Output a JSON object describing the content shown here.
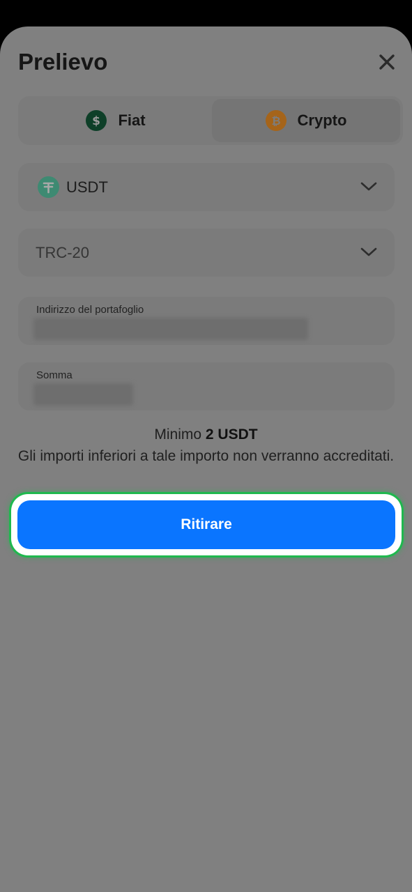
{
  "header": {
    "title": "Prelievo",
    "close_icon": "close-icon"
  },
  "tabs": [
    {
      "label": "Fiat",
      "icon": "dollar-coin-icon",
      "icon_glyph": "$",
      "color": "#0e3f28"
    },
    {
      "label": "Crypto",
      "icon": "bitcoin-coin-icon",
      "icon_glyph": "₿",
      "color": "#a5641a",
      "selected": true
    }
  ],
  "currency_select": {
    "value": "USDT",
    "icon": "tether-icon",
    "icon_glyph": "₮",
    "color": "#3e8a72"
  },
  "network_select": {
    "value": "TRC-20"
  },
  "wallet_field": {
    "label": "Indirizzo del portafoglio"
  },
  "amount_field": {
    "label": "Somma"
  },
  "notice": {
    "prefix": "Minimo",
    "amount": "2 USDT",
    "text": "Gli importi inferiori a tale importo non verranno accreditati."
  },
  "submit": {
    "label": "Ritirare",
    "color": "#0a75ff",
    "highlight_color": "#1fb84e"
  }
}
